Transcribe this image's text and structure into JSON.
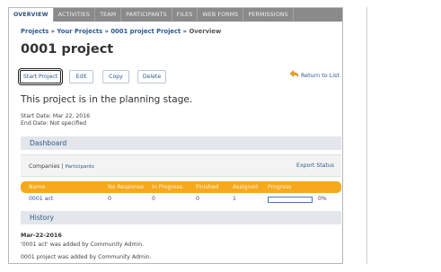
{
  "tabs": [
    {
      "label": "OVERVIEW",
      "active": true
    },
    {
      "label": "ACTIVITIES"
    },
    {
      "label": "TEAM"
    },
    {
      "label": "PARTICIPANTS"
    },
    {
      "label": "FILES"
    },
    {
      "label": "WEB FORMS"
    },
    {
      "label": "PERMISSIONS"
    }
  ],
  "breadcrumb": {
    "projects": "Projects",
    "sep": " » ",
    "your_projects": "Your Projects",
    "project": "0001 project Project",
    "current": "Overview"
  },
  "page_title": "0001 project",
  "toolbar": {
    "start_project": "Start Project",
    "edit": "Edit",
    "copy": "Copy",
    "delete": "Delete",
    "return_to_list": "Return to List"
  },
  "stage_text": "This project is in the planning stage.",
  "dates": {
    "start": "Start Date: Mar 22, 2016",
    "end": "End Date: Not specified"
  },
  "dashboard": {
    "title": "Dashboard",
    "companies_label": "Companies",
    "separator": " | ",
    "participants_link": "Participants",
    "export_status": "Export Status",
    "columns": [
      "Name",
      "No Response",
      "In Progress",
      "Finished",
      "Assigned",
      "Progress"
    ],
    "rows": [
      {
        "name": "0001 act",
        "no_response": "0",
        "in_progress": "0",
        "finished": "0",
        "assigned": "1",
        "progress_fraction": 0,
        "progress_label": "0%"
      }
    ]
  },
  "history": {
    "title": "History",
    "date": "Mar-22-2016",
    "items": [
      "'0001 act' was added by Community Admin.",
      "0001 project was added by Community Admin."
    ]
  },
  "colors": {
    "tab_bar": "#8a8a8a",
    "link": "#2c5a8f",
    "table_header": "#f5a91c",
    "section_header": "#e3e6ea",
    "progress": "#4a78b0"
  },
  "icons": {
    "return_to_list": "return-arrow-icon"
  }
}
